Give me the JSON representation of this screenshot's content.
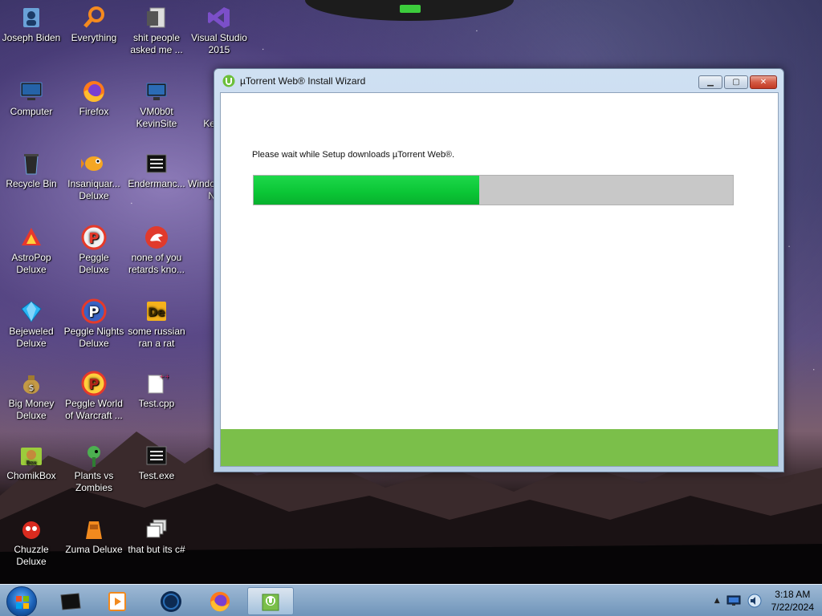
{
  "desktop": {
    "icons": [
      {
        "label": "Joseph Biden"
      },
      {
        "label": "Everything"
      },
      {
        "label": "shit people asked me ..."
      },
      {
        "label": "Visual Studio 2015"
      },
      {
        "label": "Computer"
      },
      {
        "label": "Firefox"
      },
      {
        "label": "VM0b0t KevinSite"
      },
      {
        "label": "Ke"
      },
      {
        "label": "Recycle Bin"
      },
      {
        "label": "Insaniquar... Deluxe"
      },
      {
        "label": "Endermanc..."
      },
      {
        "label": "Windo N"
      },
      {
        "label": "AstroPop Deluxe"
      },
      {
        "label": "Peggle Deluxe"
      },
      {
        "label": "none of you retards kno..."
      },
      {
        "label": "Bejeweled Deluxe"
      },
      {
        "label": "Peggle Nights Deluxe"
      },
      {
        "label": "some russian ran a rat"
      },
      {
        "label": "Big Money Deluxe"
      },
      {
        "label": "Peggle World of Warcraft ..."
      },
      {
        "label": "Test.cpp"
      },
      {
        "label": "ChomikBox"
      },
      {
        "label": "Plants vs Zombies"
      },
      {
        "label": "Test.exe"
      },
      {
        "label": "Chuzzle Deluxe"
      },
      {
        "label": "Zuma Deluxe"
      },
      {
        "label": "that but its c#"
      }
    ]
  },
  "window": {
    "title": "µTorrent Web® Install Wizard",
    "icon": "utorrent-icon",
    "buttons": {
      "minimize": "minimize-icon",
      "maximize": "maximize-icon",
      "close": "close-icon"
    },
    "message": "Please wait while Setup downloads µTorrent Web®.",
    "progress": {
      "fraction": 0.47,
      "fill_color": "#0ac535",
      "track_color": "#c8c8c8"
    },
    "footer_color": "#7bbf4a"
  },
  "taskbar": {
    "items": [
      {
        "icon": "start-orb-icon"
      },
      {
        "icon": "terminal-icon"
      },
      {
        "icon": "media-player-icon"
      },
      {
        "icon": "globe-icon"
      },
      {
        "icon": "firefox-icon"
      },
      {
        "icon": "utorrent-installer-icon",
        "active": true
      }
    ],
    "tray": {
      "icons": [
        "show-hidden-icons-arrow",
        "network-icon",
        "volume-icon"
      ],
      "time": "3:18 AM",
      "date": "7/22/2024"
    }
  }
}
